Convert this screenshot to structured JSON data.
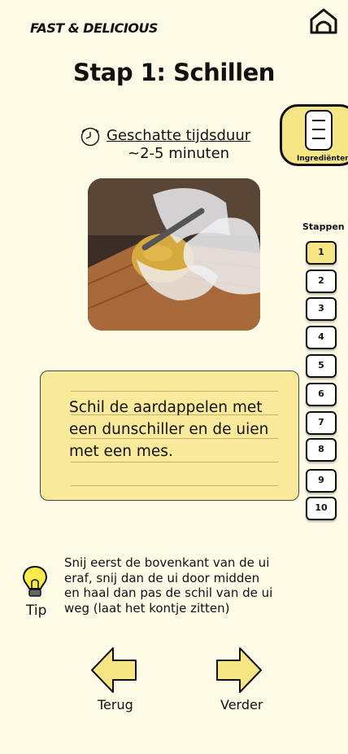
{
  "header": {
    "logo_text": "FAST & DELICIOUS"
  },
  "page_title": "Stap 1: Schillen",
  "ingredients_button": {
    "label": "Ingrediënten"
  },
  "duration": {
    "label": "Geschatte tijdsduur",
    "value": "~2-5 minuten"
  },
  "steps": {
    "label": "Stappen",
    "items": [
      "1",
      "2",
      "3",
      "4",
      "5",
      "6",
      "7",
      "8",
      "9",
      "10"
    ],
    "active_index": 0
  },
  "instruction": {
    "text": "Schil de aardappelen met een dunschiller en de uien met een mes."
  },
  "tip": {
    "label": "Tip",
    "text": "Snij eerst de bovenkant van de ui eraf, snij dan de ui door midden en haal dan pas de schil van de ui weg (laat het kontje zitten)"
  },
  "navigation": {
    "back_label": "Terug",
    "next_label": "Verder"
  },
  "colors": {
    "background": "#fdfbe6",
    "accent": "#f6e584",
    "card": "#f9e99a",
    "text": "#111111"
  }
}
